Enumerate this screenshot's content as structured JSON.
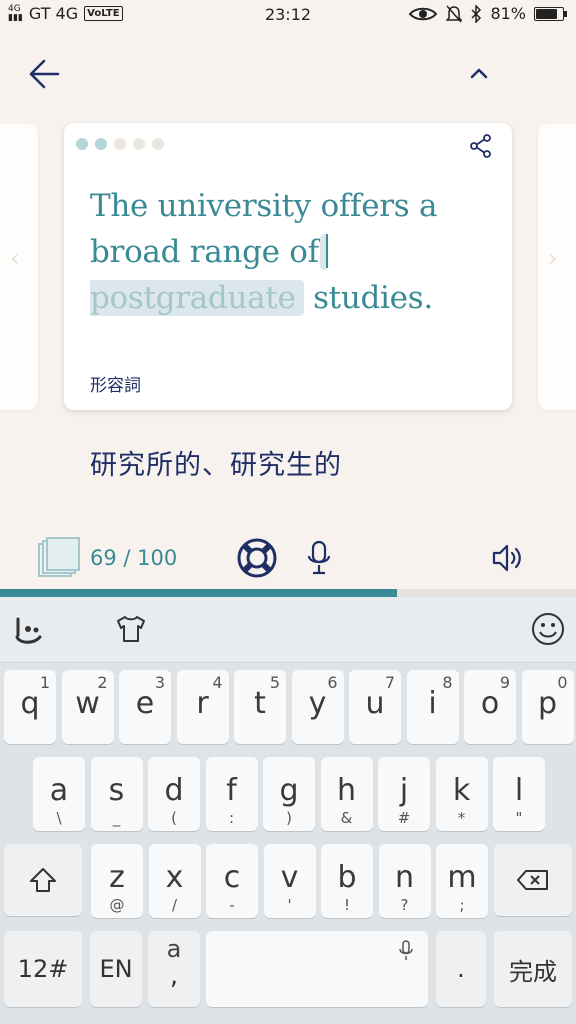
{
  "status_bar": {
    "signal_small": "4G",
    "carrier": "GT 4G",
    "volte": "VoLTE",
    "time": "23:12",
    "battery": "81%",
    "battery_level": 0.81
  },
  "nav": {
    "back_icon": "arrow-left-icon",
    "collapse_icon": "chevron-up-icon"
  },
  "card": {
    "progress_dots": [
      true,
      true,
      false,
      false,
      false
    ],
    "share_icon": "share-icon",
    "sentence_before": "The university offers a broad range of ",
    "blank_hint": "postgraduate",
    "sentence_after": " studies.",
    "part_of_speech": "形容詞"
  },
  "meaning": "研究所的、研究生的",
  "progress": {
    "count": "69 / 100",
    "fraction": 0.69,
    "help_icon": "lifebuoy-icon",
    "mic_icon": "microphone-icon",
    "speaker_icon": "speaker-icon"
  },
  "keyboard": {
    "toolbar": {
      "left_icon": "swype-icon",
      "theme_icon": "tshirt-icon",
      "emoji_icon": "smiley-icon"
    },
    "row1": [
      {
        "k": "q",
        "s": "1"
      },
      {
        "k": "w",
        "s": "2"
      },
      {
        "k": "e",
        "s": "3"
      },
      {
        "k": "r",
        "s": "4"
      },
      {
        "k": "t",
        "s": "5"
      },
      {
        "k": "y",
        "s": "6"
      },
      {
        "k": "u",
        "s": "7"
      },
      {
        "k": "i",
        "s": "8"
      },
      {
        "k": "o",
        "s": "9"
      },
      {
        "k": "p",
        "s": "0"
      }
    ],
    "row2": [
      {
        "k": "a",
        "s": "\\"
      },
      {
        "k": "s",
        "s": "_"
      },
      {
        "k": "d",
        "s": "("
      },
      {
        "k": "f",
        "s": ":"
      },
      {
        "k": "g",
        "s": ")"
      },
      {
        "k": "h",
        "s": "&"
      },
      {
        "k": "j",
        "s": "#"
      },
      {
        "k": "k",
        "s": "*"
      },
      {
        "k": "l",
        "s": "\""
      }
    ],
    "row3": [
      {
        "k": "z",
        "s": "@"
      },
      {
        "k": "x",
        "s": "/"
      },
      {
        "k": "c",
        "s": "-"
      },
      {
        "k": "v",
        "s": "'"
      },
      {
        "k": "b",
        "s": "!"
      },
      {
        "k": "n",
        "s": "?"
      },
      {
        "k": "m",
        "s": ";"
      }
    ],
    "shift_icon": "shift-icon",
    "backspace_icon": "backspace-icon",
    "num_key": "12#",
    "lang_key": "EN",
    "punct_key_top": "a",
    "punct_key_bottom": ",",
    "space_mic_icon": "microphone-icon",
    "period_key": ".",
    "done_key": "完成"
  }
}
